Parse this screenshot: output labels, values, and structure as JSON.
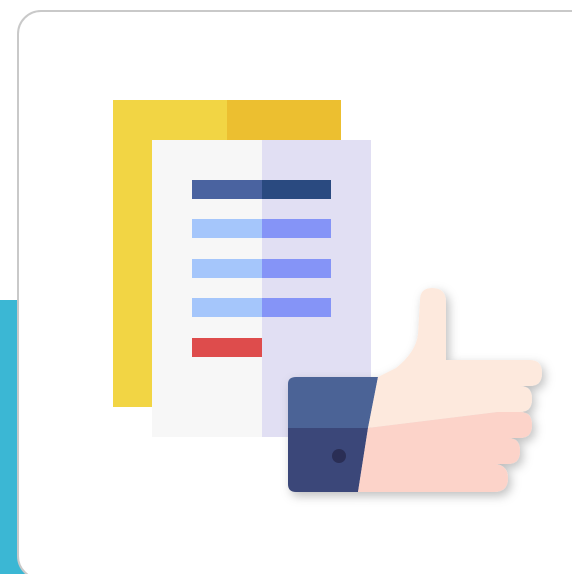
{
  "icon": "document-approval-thumbs-up-icon",
  "colors": {
    "accent_teal": "#3bb7d4",
    "card_border": "#c9c9c9",
    "folder_yellow": "#f2d544",
    "folder_yellow_dark": "#ecbf30",
    "paper_white": "#f7f7f7",
    "paper_lavender": "#e1dff3",
    "line_navy": "#4a63a0",
    "line_navy_dark": "#2a4a80",
    "line_light_blue": "#a5c6fb",
    "line_periwinkle": "#8594f7",
    "line_red": "#de4c4c",
    "cuff_blue": "#4c6396",
    "cuff_dark": "#3b4679",
    "skin_light": "#fde9dd",
    "skin_shadow": "#fcd3c9"
  }
}
